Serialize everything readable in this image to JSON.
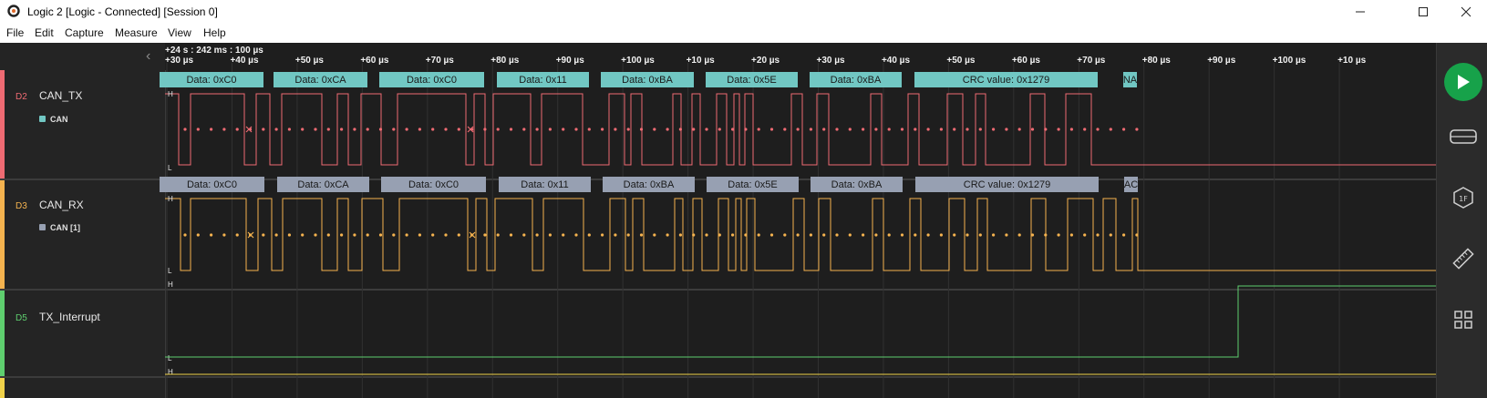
{
  "window": {
    "title": "Logic 2 [Logic - Connected] [Session 0]"
  },
  "menu": [
    "File",
    "Edit",
    "Capture",
    "Measure",
    "View",
    "Help"
  ],
  "timeline": {
    "base": "+24 s : 242 ms : 100 µs",
    "ticks": [
      "+30 µs",
      "+40 µs",
      "+50 µs",
      "+60 µs",
      "+70 µs",
      "+80 µs",
      "+90 µs",
      "+100 µs",
      "+10 µs",
      "+20 µs",
      "+30 µs",
      "+40 µs",
      "+50 µs",
      "+60 µs",
      "+70 µs",
      "+80 µs",
      "+90 µs",
      "+100 µs",
      "+10 µs"
    ]
  },
  "channels": [
    {
      "id": "D2",
      "name": "CAN_TX",
      "color": "#ef6b73",
      "analyzer": "CAN",
      "analyzer_color": "#71c7c3"
    },
    {
      "id": "D3",
      "name": "CAN_RX",
      "color": "#f5b34f",
      "analyzer": "CAN [1]",
      "analyzer_color": "#97a0b2"
    },
    {
      "id": "D5",
      "name": "TX_Interrupt",
      "color": "#5fcf6f"
    }
  ],
  "annotations_tx": [
    "Data: 0xC0",
    "Data: 0xCA",
    "Data: 0xC0",
    "Data: 0x11",
    "Data: 0xBA",
    "Data: 0x5E",
    "Data: 0xBA",
    "CRC value: 0x1279",
    "NA"
  ],
  "annotations_rx": [
    "Data: 0xC0",
    "Data: 0xCA",
    "Data: 0xC0",
    "Data: 0x11",
    "Data: 0xBA",
    "Data: 0x5E",
    "Data: 0xBA",
    "CRC value: 0x1279",
    "AC"
  ],
  "level_labels": {
    "high": "H",
    "low": "L"
  },
  "sidebar": [
    "play-icon",
    "analyzers-icon",
    "extensions-icon",
    "measure-icon",
    "layout-icon"
  ]
}
